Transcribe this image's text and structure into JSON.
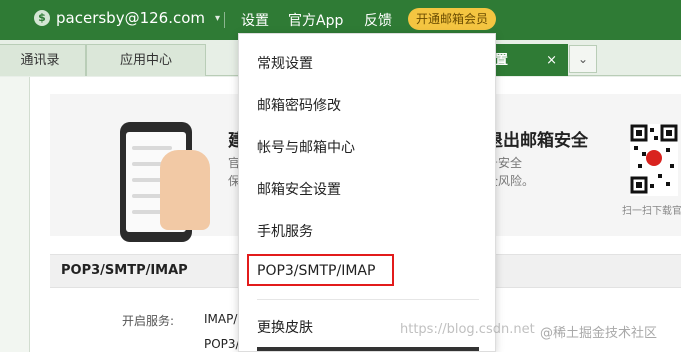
{
  "topbar": {
    "account": "pacersby@126.com",
    "nav": [
      "设置",
      "官方App",
      "反馈"
    ],
    "vip": "开通邮箱会员"
  },
  "tabs": {
    "items": [
      "通讯录",
      "应用中心"
    ],
    "active": "置",
    "active_close": "×",
    "more": "⌄"
  },
  "banner": {
    "left_title": "建",
    "left_line1": "官",
    "left_line2": "保",
    "right_title": "退出邮箱安全",
    "right_line1": "号安全",
    "right_line2": "全风险。",
    "qr_caption": "扫一扫下载官"
  },
  "section": {
    "title": "POP3/SMTP/IMAP",
    "service_label": "开启服务:",
    "service_v1": "IMAP/",
    "service_v2": "POP3/"
  },
  "menu": {
    "items": [
      "常规设置",
      "邮箱密码修改",
      "帐号与邮箱中心",
      "邮箱安全设置",
      "手机服务",
      "POP3/SMTP/IMAP",
      "更换皮肤"
    ]
  },
  "watermark": "https://blog.csdn.net",
  "watermark2": "@稀土掘金技术社区",
  "colors": {
    "brand_green": "#2f7b35",
    "vip_yellow": "#f4c541",
    "highlight_red": "#e21b1b"
  }
}
